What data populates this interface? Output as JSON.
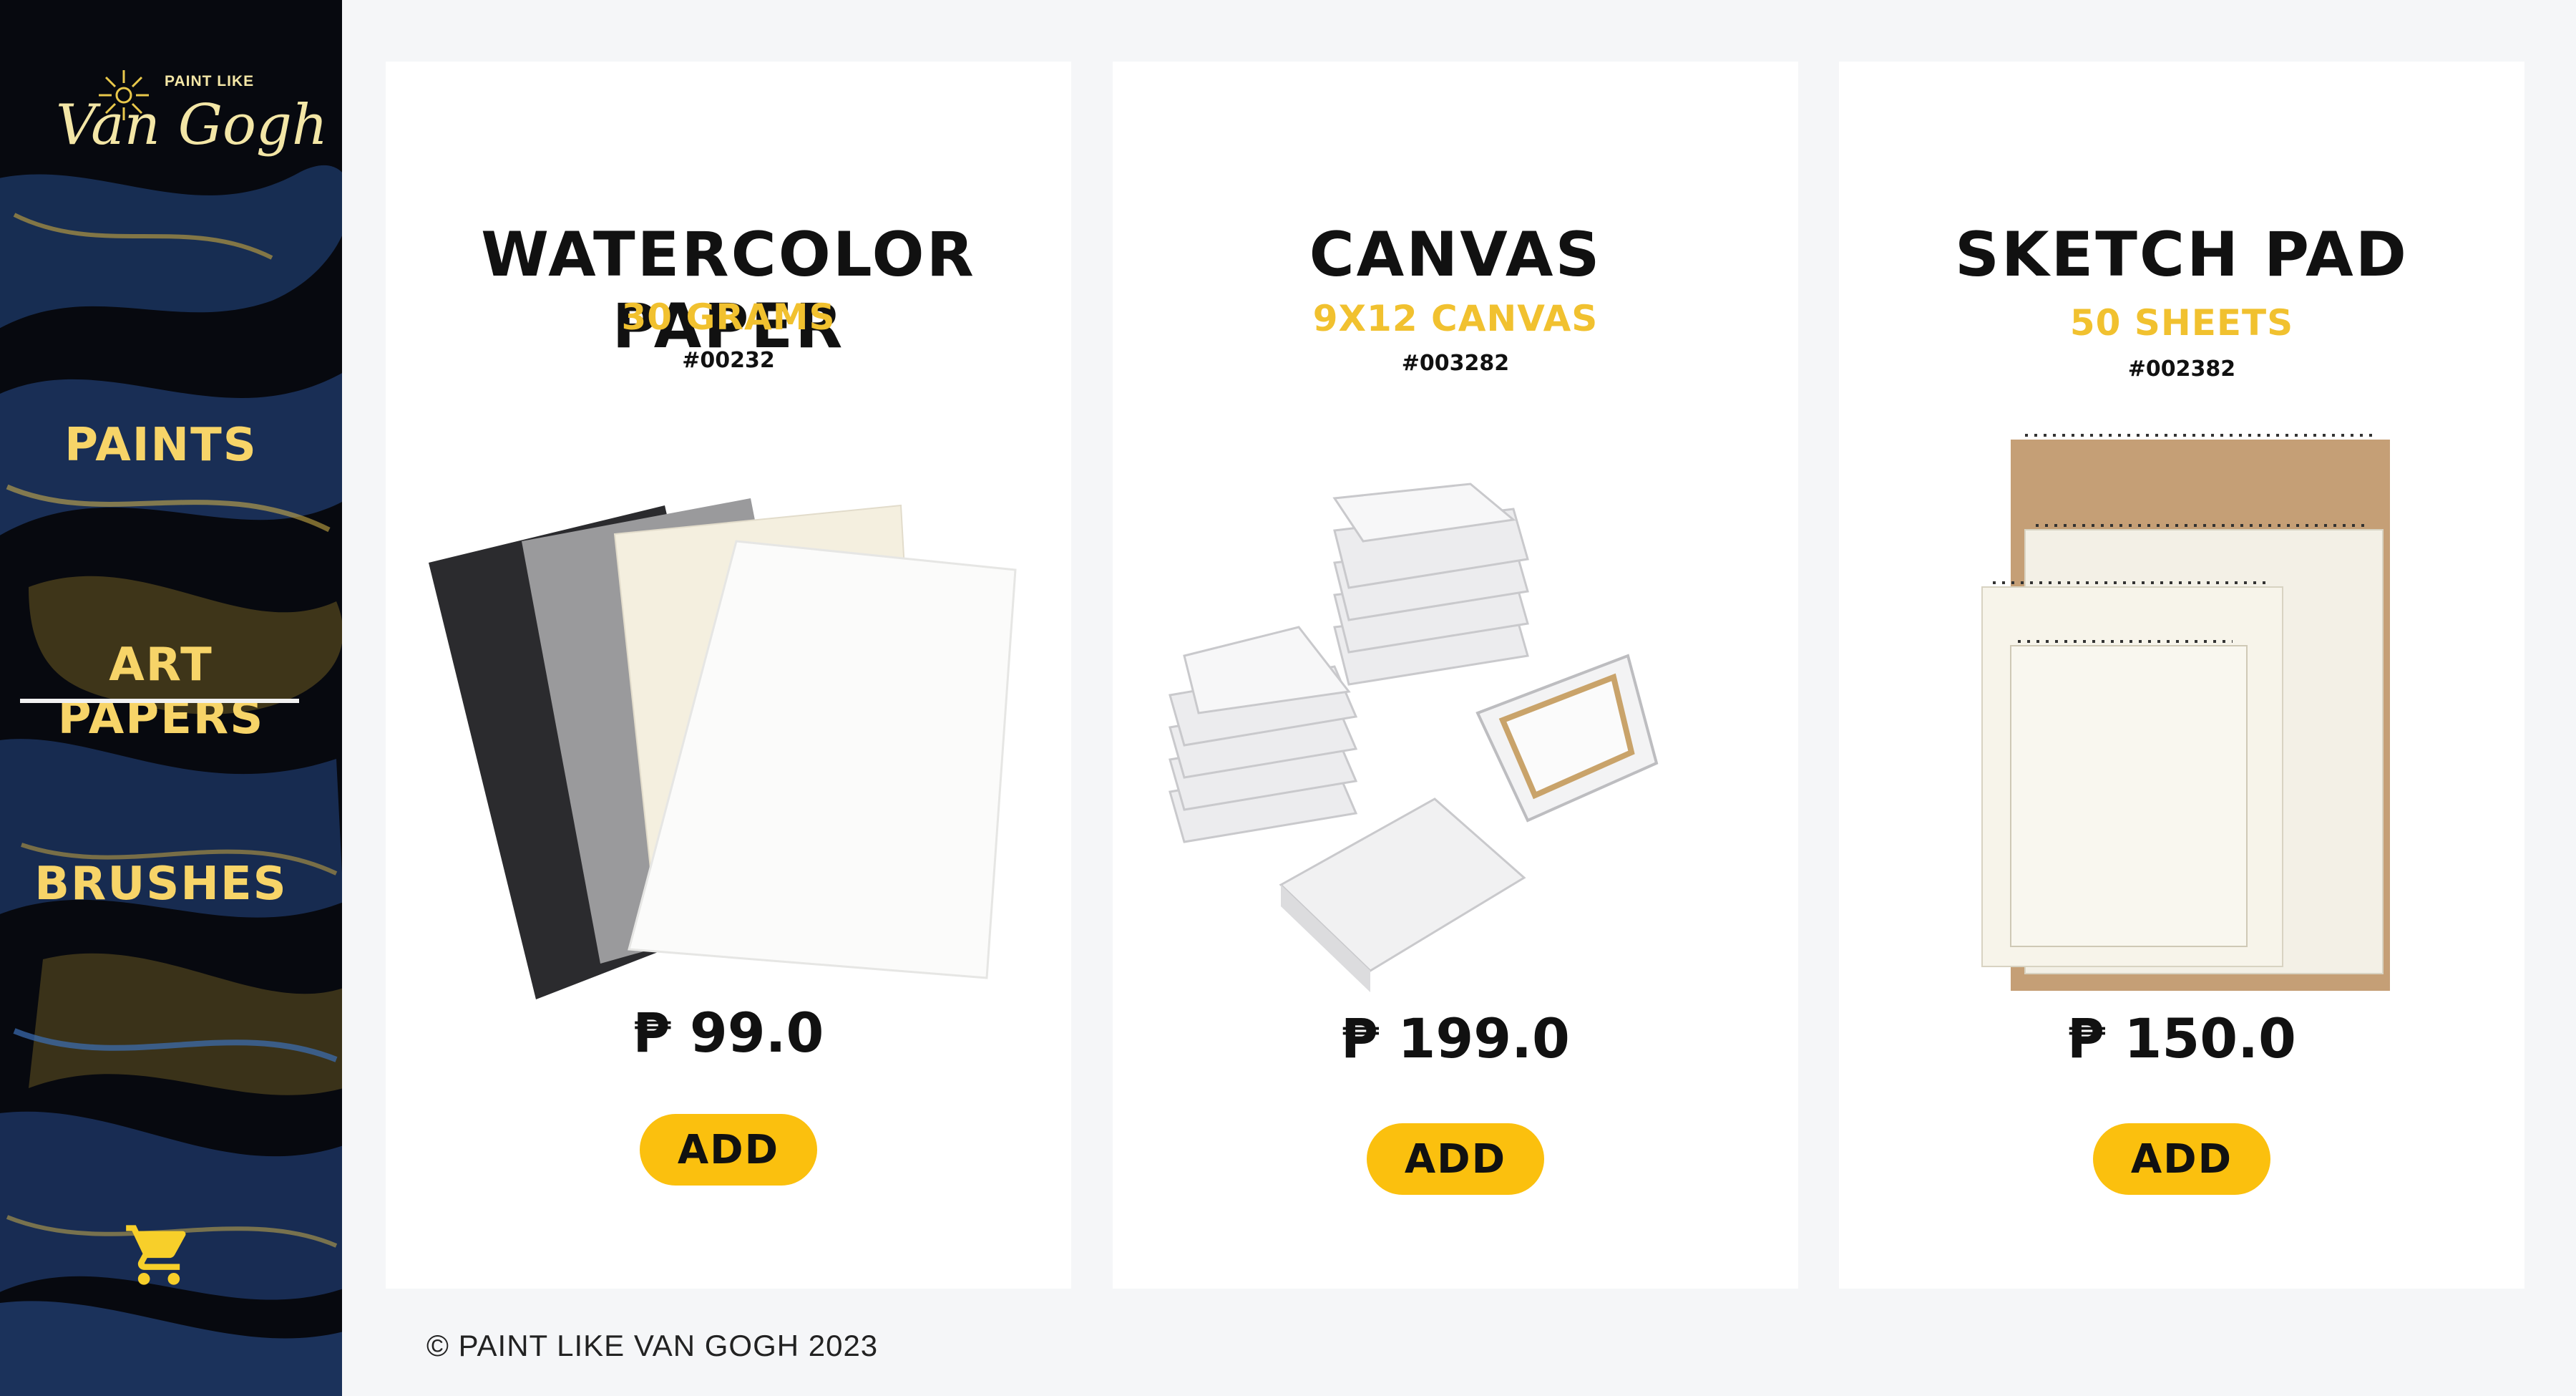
{
  "brand": {
    "small": "PAINT LIKE",
    "big": "Van Gogh"
  },
  "nav": {
    "items": [
      {
        "label": "PAINTS",
        "active": false
      },
      {
        "label": "ART PAPERS",
        "active": true
      },
      {
        "label": "BRUSHES",
        "active": false
      }
    ],
    "cart_icon": "cart-icon"
  },
  "products": [
    {
      "title": "WATERCOLOR PAPER",
      "subtitle": "30 GRAMS",
      "code": "#00232",
      "price": "₱ 99.0",
      "add_label": "ADD"
    },
    {
      "title": "CANVAS",
      "subtitle": "9X12 CANVAS",
      "code": "#003282",
      "price": "₱ 199.0",
      "add_label": "ADD"
    },
    {
      "title": "SKETCH PAD",
      "subtitle": "50 SHEETS",
      "code": "#002382",
      "price": "₱ 150.0",
      "add_label": "ADD"
    }
  ],
  "footer": {
    "text": "© PAINT LIKE VAN GOGH 2023"
  },
  "colors": {
    "accent": "#fbc00e",
    "nav_text": "#f7d468",
    "subtitle": "#f1c12f",
    "sidebar_bg": "#07090f"
  }
}
